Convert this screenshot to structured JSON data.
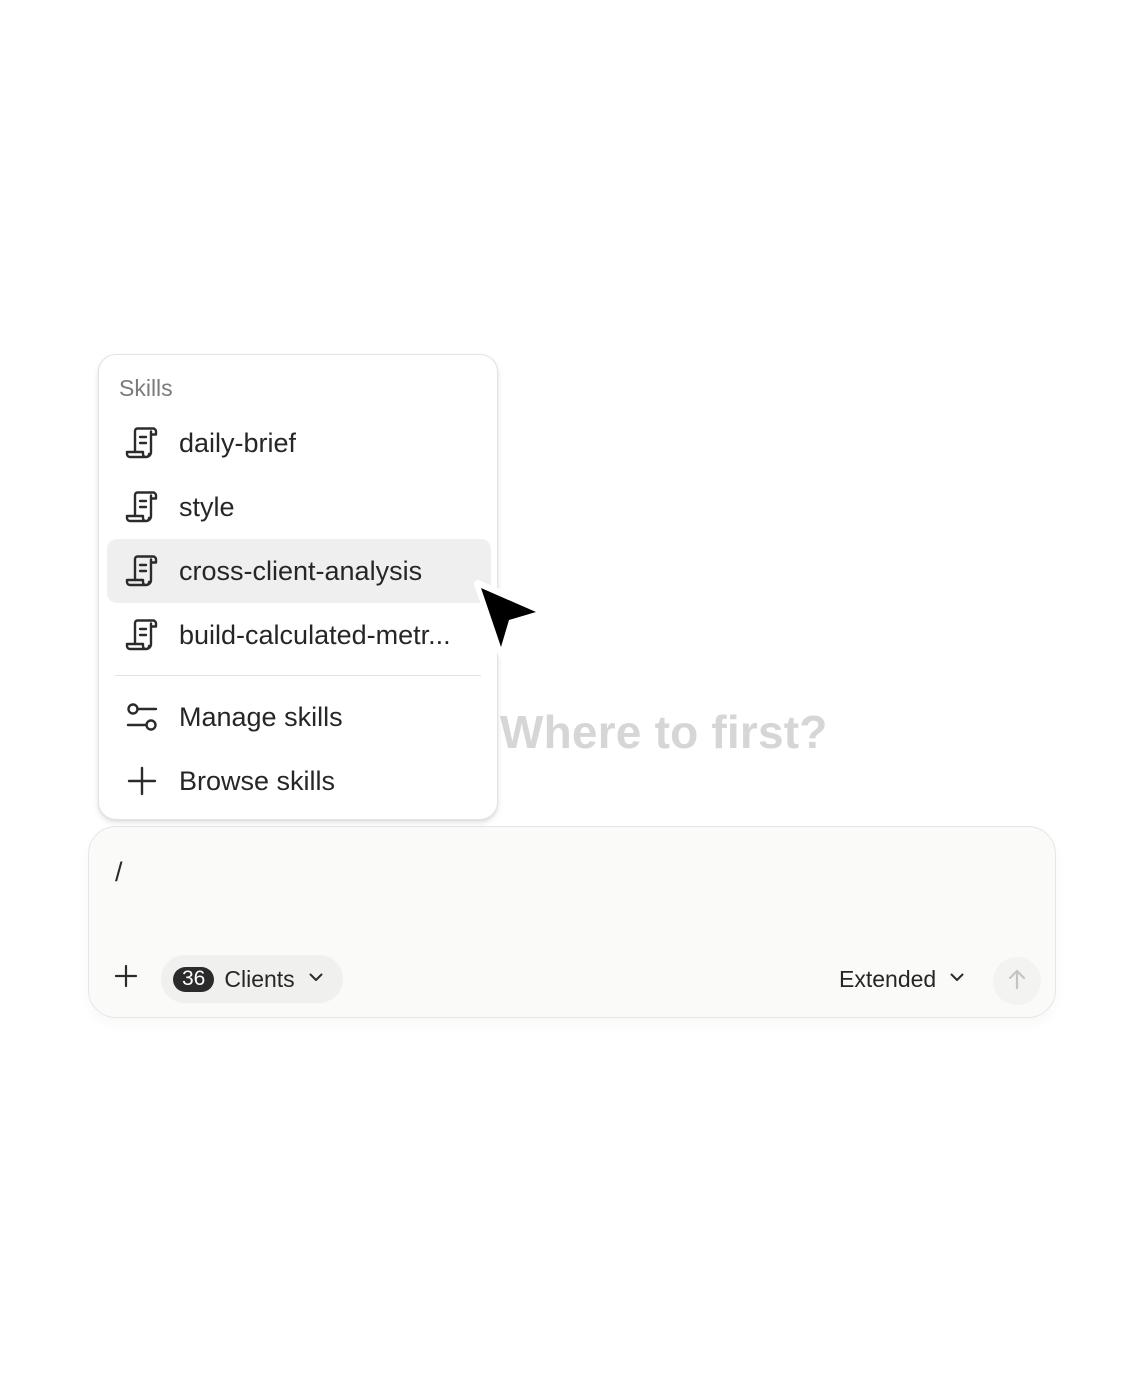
{
  "hero": {
    "title": "Where to first?"
  },
  "skills_menu": {
    "heading": "Skills",
    "items": [
      {
        "label": "daily-brief",
        "icon": "scroll-icon"
      },
      {
        "label": "style",
        "icon": "scroll-icon"
      },
      {
        "label": "cross-client-analysis",
        "icon": "scroll-icon",
        "state": "hovered"
      },
      {
        "label": "build-calculated-metr...",
        "icon": "scroll-icon"
      }
    ],
    "actions": [
      {
        "label": "Manage skills",
        "icon": "sliders-icon"
      },
      {
        "label": "Browse skills",
        "icon": "plus-icon"
      }
    ]
  },
  "composer": {
    "input_value": "/",
    "clients": {
      "count": "36",
      "label": "Clients"
    },
    "mode": "Extended",
    "send_icon": "arrow-up-icon",
    "attach_icon": "plus-icon"
  },
  "colors": {
    "hover_bg": "#efefef",
    "hero_text": "#d6d6d6",
    "badge_bg": "#2b2b2b"
  }
}
